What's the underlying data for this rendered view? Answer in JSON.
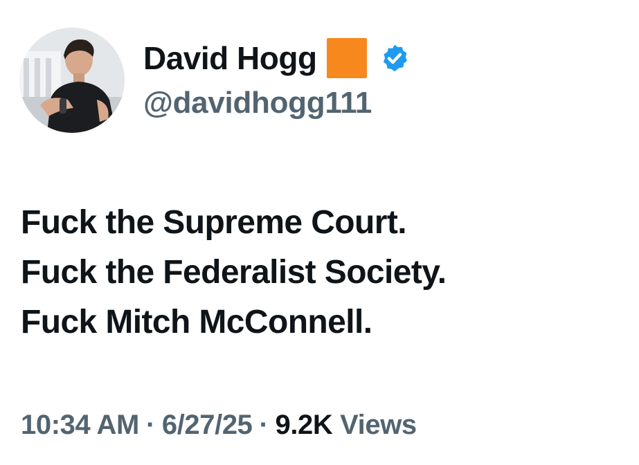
{
  "author": {
    "display_name": "David Hogg",
    "handle": "@davidhogg111",
    "flag_color": "#f7881d",
    "verified_badge_color": "#1d9bf0",
    "avatar_icon": "profile-photo"
  },
  "tweet": {
    "lines": [
      "Fuck the Supreme Court.",
      "Fuck the Federalist Society.",
      "Fuck Mitch McConnell."
    ]
  },
  "meta": {
    "time": "10:34 AM",
    "separator": "·",
    "date": "6/27/25",
    "views_count": "9.2K",
    "views_label": "Views"
  }
}
